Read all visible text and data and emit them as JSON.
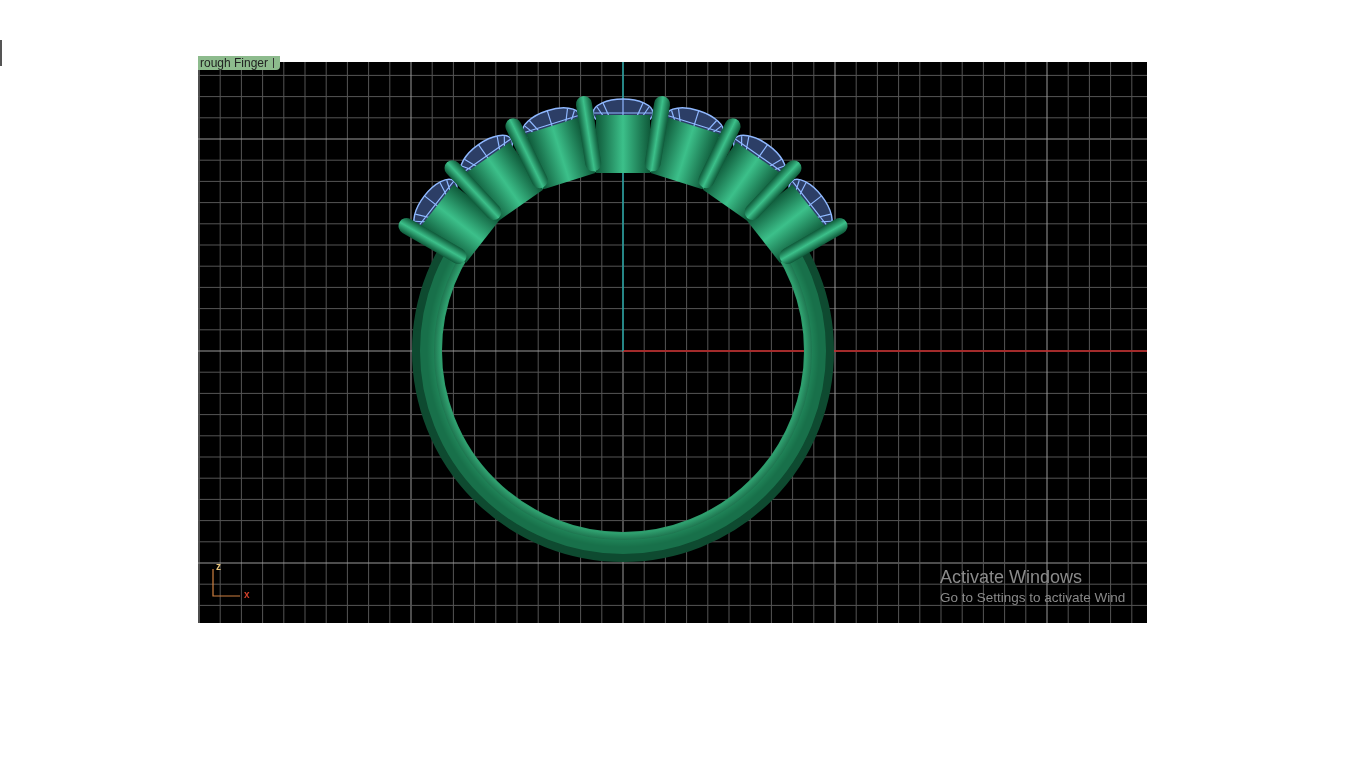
{
  "viewport": {
    "tab_label": "rough Finger"
  },
  "axis_icon": {
    "labels": [
      "z",
      "x"
    ]
  },
  "activation_notice": {
    "title": "Activate Windows",
    "message": "Go to Settings to activate Wind"
  }
}
